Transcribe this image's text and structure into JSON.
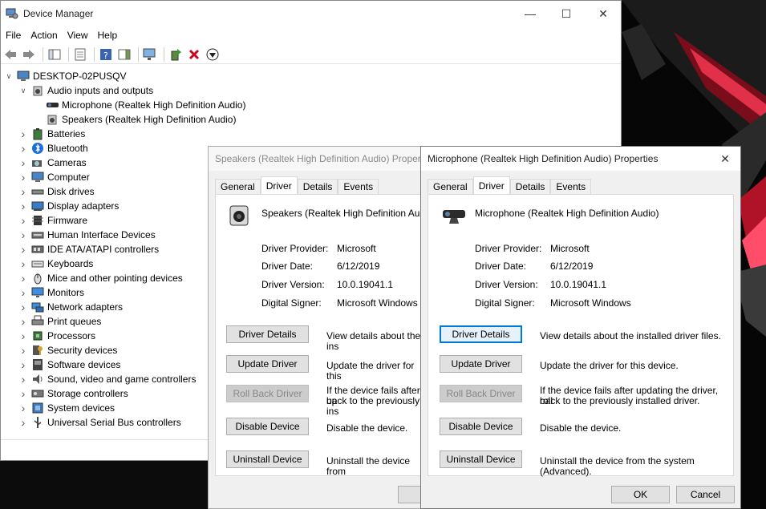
{
  "device_manager": {
    "title": "Device Manager",
    "menu": [
      "File",
      "Action",
      "View",
      "Help"
    ],
    "root": "DESKTOP-02PUSQV",
    "tree": [
      {
        "label": "Audio inputs and outputs",
        "icon": "speaker-icon",
        "expanded": true
      },
      {
        "label": "Microphone (Realtek High Definition Audio)",
        "icon": "webcam-microphone-icon",
        "child": true
      },
      {
        "label": "Speakers (Realtek High Definition Audio)",
        "icon": "speaker-icon",
        "child": true
      },
      {
        "label": "Batteries",
        "icon": "battery-icon"
      },
      {
        "label": "Bluetooth",
        "icon": "bluetooth-icon"
      },
      {
        "label": "Cameras",
        "icon": "camera-icon"
      },
      {
        "label": "Computer",
        "icon": "computer-icon"
      },
      {
        "label": "Disk drives",
        "icon": "disk-drive-icon"
      },
      {
        "label": "Display adapters",
        "icon": "display-adapter-icon"
      },
      {
        "label": "Firmware",
        "icon": "firmware-icon"
      },
      {
        "label": "Human Interface Devices",
        "icon": "hid-icon"
      },
      {
        "label": "IDE ATA/ATAPI controllers",
        "icon": "ide-controller-icon"
      },
      {
        "label": "Keyboards",
        "icon": "keyboard-icon"
      },
      {
        "label": "Mice and other pointing devices",
        "icon": "mouse-icon"
      },
      {
        "label": "Monitors",
        "icon": "monitor-icon"
      },
      {
        "label": "Network adapters",
        "icon": "network-adapter-icon"
      },
      {
        "label": "Print queues",
        "icon": "printer-icon"
      },
      {
        "label": "Processors",
        "icon": "processor-icon"
      },
      {
        "label": "Security devices",
        "icon": "security-device-icon"
      },
      {
        "label": "Software devices",
        "icon": "software-device-icon"
      },
      {
        "label": "Sound, video and game controllers",
        "icon": "sound-controller-icon"
      },
      {
        "label": "Storage controllers",
        "icon": "storage-controller-icon"
      },
      {
        "label": "System devices",
        "icon": "system-device-icon"
      },
      {
        "label": "Universal Serial Bus controllers",
        "icon": "usb-icon"
      }
    ]
  },
  "speakers_dialog": {
    "title": "Speakers (Realtek High Definition Audio) Properties",
    "title_visible": "Speakers (Realtek High Definition Audio) Propert",
    "tabs": [
      "General",
      "Driver",
      "Details",
      "Events"
    ],
    "device_name": "Speakers (Realtek High Definition Audio)",
    "provider_label": "Driver Provider:",
    "provider": "Microsoft",
    "date_label": "Driver Date:",
    "date": "6/12/2019",
    "version_label": "Driver Version:",
    "version": "10.0.19041.1",
    "signer_label": "Digital Signer:",
    "signer": "Microsoft Windows",
    "details_btn": "Driver Details",
    "details_desc": "View details about the ins",
    "update_btn": "Update Driver",
    "update_desc": "Update the driver for this",
    "rollback_btn": "Roll Back Driver",
    "rollback_desc1": "If the device fails after up",
    "rollback_desc2": "back to the previously ins",
    "disable_btn": "Disable Device",
    "disable_desc": "Disable the device.",
    "uninstall_btn": "Uninstall Device",
    "uninstall_desc": "Uninstall the device from"
  },
  "microphone_dialog": {
    "title": "Microphone (Realtek High Definition Audio) Properties",
    "tabs": [
      "General",
      "Driver",
      "Details",
      "Events"
    ],
    "device_name": "Microphone (Realtek High Definition Audio)",
    "provider_label": "Driver Provider:",
    "provider": "Microsoft",
    "date_label": "Driver Date:",
    "date": "6/12/2019",
    "version_label": "Driver Version:",
    "version": "10.0.19041.1",
    "signer_label": "Digital Signer:",
    "signer": "Microsoft Windows",
    "details_btn": "Driver Details",
    "details_desc": "View details about the installed driver files.",
    "update_btn": "Update Driver",
    "update_desc": "Update the driver for this device.",
    "rollback_btn": "Roll Back Driver",
    "rollback_desc1": "If the device fails after updating the driver, roll",
    "rollback_desc2": "back to the previously installed driver.",
    "disable_btn": "Disable Device",
    "disable_desc": "Disable the device.",
    "uninstall_btn": "Uninstall Device",
    "uninstall_desc": "Uninstall the device from the system (Advanced).",
    "ok": "OK",
    "cancel": "Cancel"
  },
  "colors": {
    "accent": "#0078d7",
    "wallpaper_red": "#c8102e"
  }
}
